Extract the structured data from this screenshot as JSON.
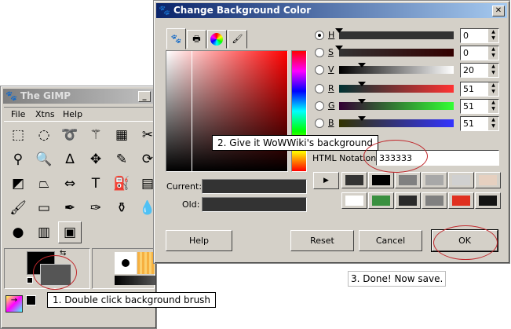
{
  "toolbox": {
    "title": "The GIMP",
    "menu": [
      "File",
      "Xtns",
      "Help"
    ],
    "tools": [
      "rect-select",
      "ellipse-select",
      "lasso",
      "fuzzy-select",
      "color-select",
      "scissors",
      "color-picker",
      "magnify",
      "measure",
      "move",
      "crop",
      "transform",
      "perspective",
      "flip",
      "flip-h",
      "text",
      "bucket-fill",
      "blend",
      "paintbrush",
      "eraser",
      "airbrush",
      "ink",
      "clone",
      "smudge",
      "dodge-burn",
      "levels",
      "color-dialog"
    ]
  },
  "dialog": {
    "title": "Change Background Color",
    "tabs": [
      "gimp-selector",
      "printer-cmyk",
      "color-wheel",
      "watercolor"
    ],
    "current_label": "Current:",
    "old_label": "Old:",
    "channels": [
      {
        "label": "H",
        "value": "0",
        "pos": 0,
        "selected": true
      },
      {
        "label": "S",
        "value": "0",
        "pos": 0
      },
      {
        "label": "V",
        "value": "20",
        "pos": 0.2
      },
      {
        "label": "R",
        "value": "51",
        "pos": 0.2
      },
      {
        "label": "G",
        "value": "51",
        "pos": 0.2
      },
      {
        "label": "B",
        "value": "51",
        "pos": 0.2
      }
    ],
    "html_label": "HTML Notation:",
    "html_value": "333333",
    "history": [
      "#333333",
      "#000000",
      "#808080",
      "#a8a8a8",
      "#d0d0d0",
      "#e6d0c0",
      "#ffffff",
      "#3a9040",
      "#2a2a2a",
      "#808080",
      "#e03020",
      "#141414"
    ],
    "buttons": {
      "help": "Help",
      "reset": "Reset",
      "cancel": "Cancel",
      "ok": "OK"
    }
  },
  "callouts": {
    "step1": "1. Double click background brush",
    "step2": "2. Give it WoWWiki's background",
    "step3": "3. Done! Now save."
  }
}
